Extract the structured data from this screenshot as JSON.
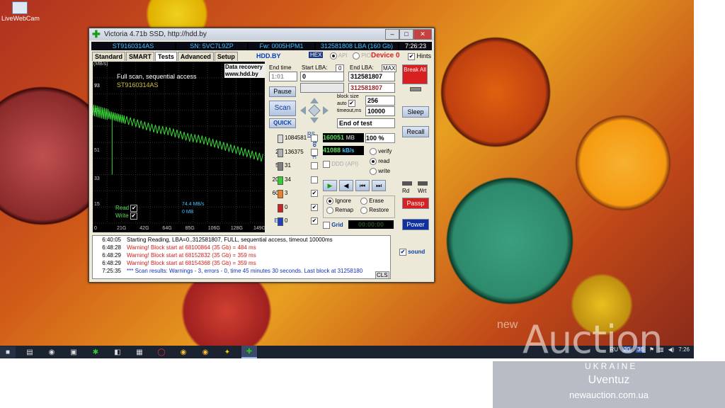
{
  "desktop": {
    "icon_label": "LiveWebCam"
  },
  "window": {
    "title": "Victoria 4.71b SSD, http://hdd.by",
    "info": {
      "model": "ST9160314AS",
      "sn": "SN: 5VC7L9ZP",
      "fw": "Fw: 0005HPM1",
      "lba": "312581808 LBA (160 Gb)",
      "time": "7:26:23"
    },
    "tabs": [
      "Standard",
      "SMART",
      "Tests",
      "Advanced",
      "Setup"
    ],
    "hdd_label": "HDD.BY",
    "hex_label": "HEX",
    "api_label": "API",
    "pio_label": "PIO",
    "device_label": "Device 0",
    "hints_label": "Hints"
  },
  "chart": {
    "mbs_label": "(MB/s)",
    "title_line1": "Full scan, sequential access",
    "title_line2": "ST9160314AS",
    "data_recovery": [
      "Data recovery",
      "www.hdd.by"
    ],
    "read_label": "Read",
    "write_label": "Write",
    "speed_text": "74.4 MB/s",
    "mb_text": "0 MB"
  },
  "chart_data": {
    "type": "line",
    "title": "Full scan, sequential access",
    "ylabel": "(MB/s)",
    "xlabel": "",
    "x_ticks": [
      "0",
      "21G",
      "42G",
      "64G",
      "85G",
      "106G",
      "128G",
      "149G"
    ],
    "y_ticks": [
      "15",
      "33",
      "51",
      "77",
      "73",
      "93"
    ],
    "xlim": [
      0,
      160
    ],
    "ylim": [
      0,
      100
    ],
    "series": [
      {
        "name": "Read",
        "x": [
          0,
          5,
          10,
          15,
          20,
          25,
          30,
          40,
          50,
          60,
          70,
          80,
          90,
          100,
          110,
          120,
          130,
          140,
          150,
          160
        ],
        "y": [
          70,
          69,
          68,
          67,
          66,
          65,
          64,
          62,
          60,
          58,
          57,
          55,
          53,
          52,
          50,
          48,
          46,
          44,
          42,
          40
        ]
      }
    ]
  },
  "controls": {
    "end_time_label": "End time",
    "end_time_value": "1:01",
    "start_lba_label": "Start LBA:",
    "start_lba_zero": "0",
    "start_lba_value": "0",
    "end_lba_label": "End LBA:",
    "max_label": "MAX",
    "end_lba_value": "312581807",
    "end_lba_current": "312581807",
    "pause_label": "Pause",
    "scan_label": "Scan",
    "quick_label": "QUICK",
    "block_size_label": "block size",
    "auto_label": "auto",
    "block_size_value": "256",
    "timeout_label": "timeout,ms",
    "timeout_value": "10000",
    "end_of_test": "End of test"
  },
  "blocks": {
    "rs_label": "RS",
    "to_log_label": "to log:",
    "rows": [
      {
        "ms": "5",
        "count": "1084581",
        "color": "#d8d8d8",
        "checked": ""
      },
      {
        "ms": "20",
        "count": "136375",
        "color": "#b0b0b0",
        "checked": ""
      },
      {
        "ms": "50",
        "count": "31",
        "color": "#808080",
        "checked": ""
      },
      {
        "ms": "200",
        "count": "34",
        "color": "#30d030",
        "checked": ""
      },
      {
        "ms": "600",
        "count": "3",
        "color": "#f08020",
        "checked": "✔"
      },
      {
        "ms": ">",
        "count": "0",
        "color": "#d02020",
        "checked": "✔"
      },
      {
        "ms": "Err",
        "count": "0",
        "color": "#2040c0",
        "checked": "✔"
      }
    ]
  },
  "status": {
    "mb_value": "160051",
    "mb_unit": "MB",
    "percent_value": "100",
    "percent_unit": "%",
    "speed_value": "41088",
    "speed_unit": "kB/s",
    "ddd_label": "DDD (API)",
    "verify_label": "verify",
    "read_label": "read",
    "write_label": "write",
    "ignore_label": "Ignore",
    "erase_label": "Erase",
    "remap_label": "Remap",
    "restore_label": "Restore",
    "grid_label": "Grid",
    "grid_timer": "00:00:00"
  },
  "right_panel": {
    "break_label": "Break All",
    "sleep_label": "Sleep",
    "recall_label": "Recall",
    "rd_label": "Rd",
    "wrt_label": "Wrt",
    "passp_label": "Passp",
    "power_label": "Power",
    "sound_label": "sound"
  },
  "log": {
    "cls_label": "CLS",
    "rows": [
      {
        "time": "6:40:05",
        "text": "Starting Reading, LBA=0..312581807, FULL, sequential access, timeout 10000ms",
        "color": "#000000"
      },
      {
        "time": "6:48:28",
        "text": "Warning! Block start at 68100864 (35 Gb)  = 484 ms",
        "color": "#d02020"
      },
      {
        "time": "6:48:29",
        "text": "Warning! Block start at 68152832 (35 Gb)  = 359 ms",
        "color": "#d02020"
      },
      {
        "time": "6:48:29",
        "text": "Warning! Block start at 68154368 (35 Gb)  = 359 ms",
        "color": "#d02020"
      },
      {
        "time": "7:25:35",
        "text": "*** Scan results: Warnings - 3, errors - 0, time 45 minutes 30 seconds. Last block at 31258180",
        "color": "#1030c0"
      }
    ]
  },
  "taskbar": {
    "lang": "RU",
    "tray_a": "30",
    "tray_b": "36",
    "clock": "7:26"
  },
  "watermark": {
    "new_text": "new",
    "auction_text": "Auction",
    "ukraine_text": "UKRAINE",
    "user_text": "Uventuz",
    "site_text": "newauction.com.ua"
  }
}
